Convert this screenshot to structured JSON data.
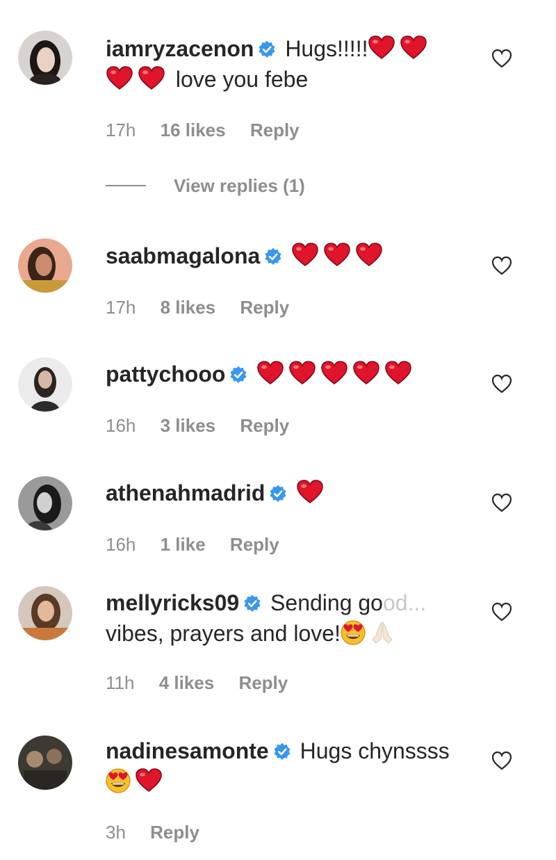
{
  "comments": [
    {
      "username": "iamryzacenon",
      "text_before": "Hugs!!!!!",
      "text_after": "love you febe",
      "time": "17h",
      "likes": "16 likes",
      "reply": "Reply",
      "view_replies": "View replies (1)"
    },
    {
      "username": "saabmagalona",
      "time": "17h",
      "likes": "8 likes",
      "reply": "Reply"
    },
    {
      "username": "pattychooo",
      "time": "16h",
      "likes": "3 likes",
      "reply": "Reply"
    },
    {
      "username": "athenahmadrid",
      "time": "16h",
      "likes": "1 like",
      "reply": "Reply"
    },
    {
      "username": "mellyricks09",
      "text_before": "Sending go",
      "text_faded": "od...",
      "text_after": "vibes, prayers and love!",
      "time": "11h",
      "likes": "4 likes",
      "reply": "Reply"
    },
    {
      "username": "nadinesamonte",
      "text_before": "Hugs chynssss",
      "time": "3h",
      "reply": "Reply"
    }
  ],
  "icons": {
    "verified": "verified-badge-icon",
    "heart_emoji": "red-heart-emoji",
    "heart_eyes_emoji": "heart-eyes-emoji",
    "pray_emoji": "folded-hands-emoji",
    "like": "heart-outline-icon"
  },
  "colors": {
    "verified_blue": "#3897f0",
    "heart_red": "#e0142a",
    "meta_gray": "#8e8e8e",
    "text": "#262626"
  }
}
